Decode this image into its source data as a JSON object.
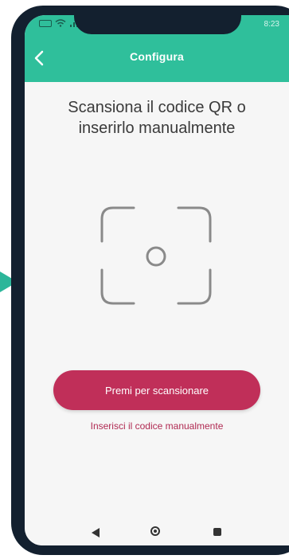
{
  "status_bar": {
    "time": "8:23",
    "icons": [
      "battery-icon",
      "wifi-icon",
      "signal-icon"
    ]
  },
  "app_bar": {
    "title": "Configura",
    "back_icon": "chevron-left-icon"
  },
  "main": {
    "heading_line1": "Scansiona il codice QR o",
    "heading_line2": "inserirlo manualmente",
    "scan_frame_icon": "qr-scan-frame-icon",
    "scan_button_label": "Premi per scansionare",
    "manual_link_label": "Inserisci il codice manualmente"
  },
  "nav_bar": {
    "items": [
      "nav-back-icon",
      "nav-home-icon",
      "nav-recent-icon"
    ]
  },
  "colors": {
    "accent": "#2fbf9b",
    "button": "#c02f59",
    "link": "#b02a52",
    "frame": "#13202f",
    "screen_bg": "#f6f6f6"
  }
}
